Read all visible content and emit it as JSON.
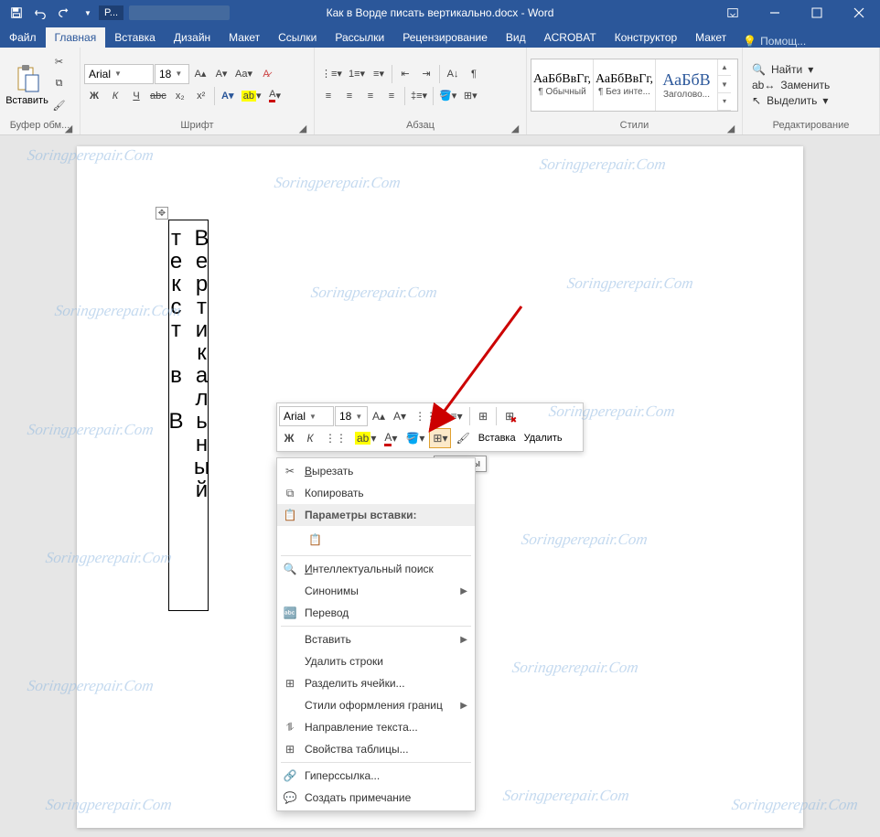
{
  "titlebar": {
    "document_title": "Как в Ворде писать вертикально.docx - Word",
    "user_initial": "P..."
  },
  "tabs": {
    "file": "Файл",
    "home": "Главная",
    "insert": "Вставка",
    "design": "Дизайн",
    "layout": "Макет",
    "references": "Ссылки",
    "mailings": "Рассылки",
    "review": "Рецензирование",
    "view": "Вид",
    "acrobat": "ACROBAT",
    "designer": "Конструктор",
    "layout2": "Макет",
    "tell_me": "Помощ..."
  },
  "ribbon": {
    "clipboard": {
      "label": "Буфер обм...",
      "paste": "Вставить"
    },
    "font": {
      "label": "Шрифт",
      "name": "Arial",
      "size": "18",
      "bold": "Ж",
      "italic": "К",
      "underline": "Ч",
      "strike": "abc",
      "sub": "x₂",
      "sup": "x²"
    },
    "paragraph": {
      "label": "Абзац"
    },
    "styles": {
      "label": "Стили",
      "items": [
        {
          "preview": "АаБбВвГг,",
          "name": "¶ Обычный"
        },
        {
          "preview": "АаБбВвГг,",
          "name": "¶ Без инте..."
        },
        {
          "preview": "АаБбВ",
          "name": "Заголово..."
        }
      ]
    },
    "editing": {
      "label": "Редактирование",
      "find": "Найти",
      "replace": "Заменить",
      "select": "Выделить"
    }
  },
  "document": {
    "vertical_text": "Вертикальный текст в В"
  },
  "mini_toolbar": {
    "font": "Arial",
    "size": "18",
    "bold": "Ж",
    "italic": "К",
    "insert": "Вставка",
    "delete": "Удалить"
  },
  "tooltip": "Границы",
  "context_menu": {
    "cut": "Вырезать",
    "copy": "Копировать",
    "paste_header": "Параметры вставки:",
    "smart_lookup": "Интеллектуальный поиск",
    "synonyms": "Синонимы",
    "translate": "Перевод",
    "insert": "Вставить",
    "delete_rows": "Удалить строки",
    "split_cells": "Разделить ячейки...",
    "border_styles": "Стили оформления границ",
    "text_direction": "Направление текста...",
    "table_props": "Свойства таблицы...",
    "hyperlink": "Гиперссылка...",
    "new_comment": "Создать примечание"
  },
  "watermark": "Soringperepair.Com"
}
